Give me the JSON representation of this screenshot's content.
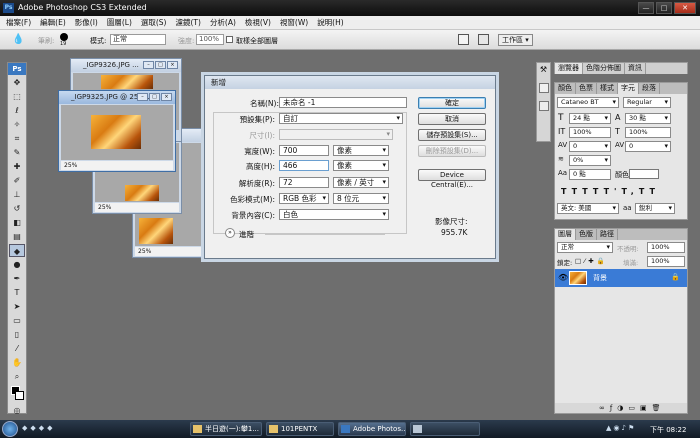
{
  "app": {
    "title": "Adobe Photoshop CS3 Extended",
    "logo": "Ps"
  },
  "window_controls": {
    "minimize": "—",
    "maximize": "□",
    "close": "✕"
  },
  "menu": [
    "檔案(F)",
    "編輯(E)",
    "影像(I)",
    "圖層(L)",
    "選取(S)",
    "濾鏡(T)",
    "分析(A)",
    "檢視(V)",
    "視窗(W)",
    "說明(H)"
  ],
  "options": {
    "mode_label": "筆刷:",
    "brush_size": "19",
    "mode_label2": "模式:",
    "mode_value": "正常",
    "strength_label": "強度:",
    "strength_value": "100%",
    "sample_all": "取樣全部圖層",
    "workspace": "工作區"
  },
  "docs": [
    {
      "title": "_IGP9326.JPG ...",
      "zoom": "25%"
    },
    {
      "title": "_IGP9325.JPG @ 25%...",
      "zoom": "25%"
    },
    {
      "title": "",
      "zoom": "25%"
    },
    {
      "title": "",
      "zoom": "25%"
    }
  ],
  "dialog": {
    "title": "新增",
    "name_label": "名稱(N):",
    "name_value": "未命名 -1",
    "preset_label": "預設集(P):",
    "preset_value": "自訂",
    "size_label": "尺寸(I):",
    "width_label": "寬度(W):",
    "width_value": "700",
    "width_unit": "像素",
    "height_label": "高度(H):",
    "height_value": "466",
    "height_unit": "像素",
    "res_label": "解析度(R):",
    "res_value": "72",
    "res_unit": "像素 / 英寸",
    "colormode_label": "色彩模式(M):",
    "colormode_value": "RGB 色彩",
    "bitdepth_value": "8 位元",
    "bg_label": "背景內容(C):",
    "bg_value": "白色",
    "advanced": "進階",
    "ok": "確定",
    "cancel": "取消",
    "save_preset": "儲存預設集(S)...",
    "delete_preset": "刪除預設集(D)...",
    "device_central": "Device Central(E)...",
    "image_size_label": "影像尺寸:",
    "image_size_value": "955.7K"
  },
  "panels": {
    "top_tabs": [
      "瀏覽器",
      "色階分佈圖",
      "資訊"
    ],
    "char_tabs": [
      "顏色",
      "色票",
      "樣式",
      "字元",
      "段落"
    ],
    "font_family": "Cataneo BT",
    "font_style": "Regular",
    "font_size": "24 點",
    "leading": "30 點",
    "vscale": "100%",
    "hscale": "100%",
    "kerning": "0",
    "tracking": "0",
    "baseline": "0%",
    "shift": "0 點",
    "color_label": "顏色:",
    "language": "英文: 美國",
    "aa_label": "aa",
    "aa_value": "銳利",
    "layer_tabs": [
      "圖層",
      "色版",
      "路徑"
    ],
    "blend_mode": "正常",
    "opacity_label": "不透明:",
    "opacity_value": "100%",
    "lock_label": "鎖定:",
    "fill_label": "填滿:",
    "fill_value": "100%",
    "layer_name": "背景"
  },
  "taskbar": {
    "items": [
      "半日遊(一):攀1...",
      "101PENTX",
      "Adobe Photos...",
      ""
    ],
    "clock": "下午 08:22"
  },
  "tools": [
    "move-icon",
    "marquee-icon",
    "lasso-icon",
    "magic-wand-icon",
    "crop-icon",
    "slice-icon",
    "healing-icon",
    "brush-icon",
    "stamp-icon",
    "history-brush-icon",
    "eraser-icon",
    "gradient-icon",
    "blur-icon",
    "dodge-icon",
    "pen-icon",
    "type-icon",
    "path-select-icon",
    "shape-icon",
    "notes-icon",
    "eyedropper-icon",
    "hand-icon",
    "zoom-icon",
    "color-swatch-icon",
    "quickmask-icon",
    "screenmode-icon"
  ]
}
